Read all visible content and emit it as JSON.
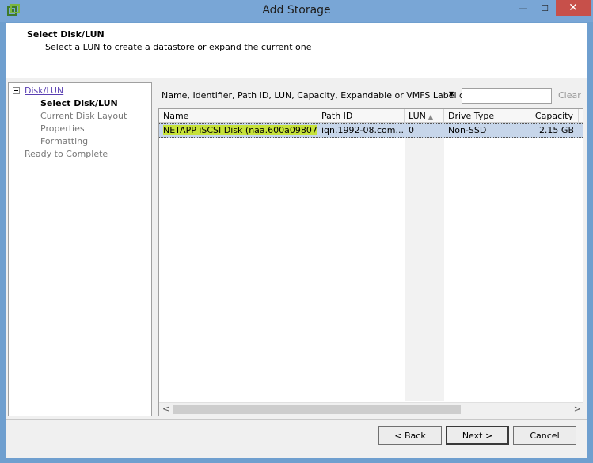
{
  "window": {
    "title": "Add Storage",
    "minimize_glyph": "—",
    "maximize_glyph": "☐",
    "close_glyph": "✕",
    "icon": "vsphere-storage-icon"
  },
  "header": {
    "title": "Select Disk/LUN",
    "subtitle": "Select a LUN to create a datastore or expand the current one"
  },
  "nav": {
    "group": "Disk/LUN",
    "items": [
      "Select Disk/LUN",
      "Current Disk Layout",
      "Properties",
      "Formatting"
    ],
    "final": "Ready to Complete"
  },
  "filter": {
    "label": "Name, Identifier, Path ID, LUN, Capacity, Expandable or VMFS Label c...",
    "dropdown_glyph": "▼",
    "search_value": "",
    "clear_label": "Clear"
  },
  "grid": {
    "columns": [
      "Name",
      "Path ID",
      "LUN",
      "Drive Type",
      "Capacity"
    ],
    "sort_glyph": "▲",
    "rows": [
      {
        "name": "NETAPP iSCSI Disk (naa.600a09807...",
        "path_id": "iqn.1992-08.com....",
        "lun": "0",
        "drive_type": "Non-SSD",
        "capacity": "2.15 GB"
      }
    ],
    "scroll_left_glyph": "<",
    "scroll_right_glyph": ">"
  },
  "buttons": {
    "back": "< Back",
    "next": "Next >",
    "cancel": "Cancel"
  },
  "colors": {
    "highlight": "#c6e23a",
    "selection": "#c7d6ea",
    "titlebar": "#79a6d6",
    "close": "#c7504a"
  }
}
